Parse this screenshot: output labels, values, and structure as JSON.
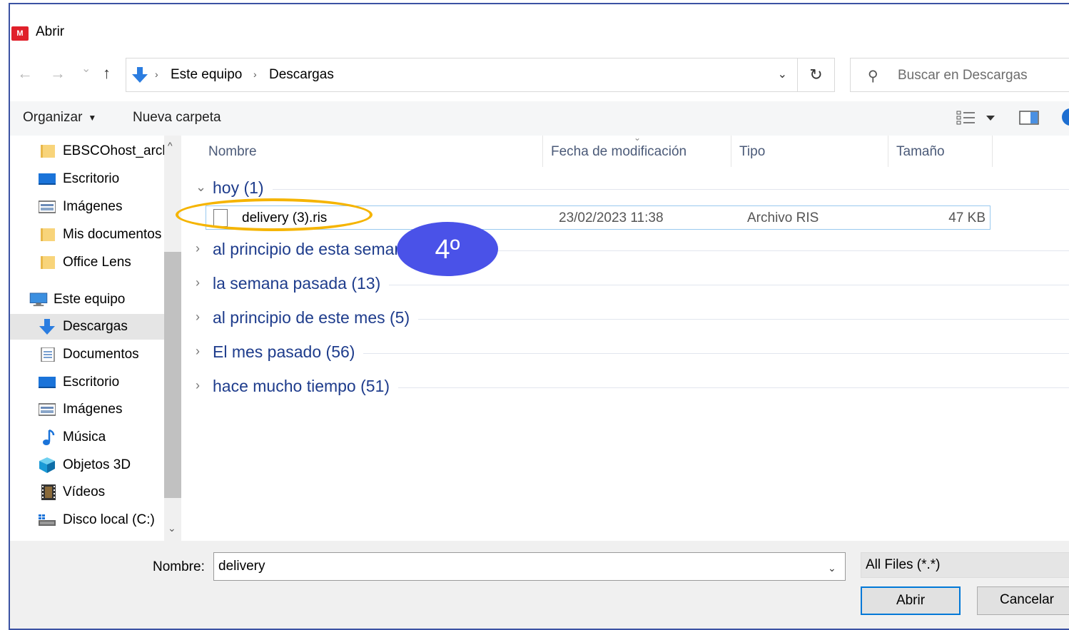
{
  "window": {
    "title": "Abrir",
    "app_icon_text": "M"
  },
  "navigation": {
    "back_icon": "←",
    "forward_icon": "→",
    "recent_icon": "⌄",
    "up_icon": "↑",
    "breadcrumb": [
      "Este equipo",
      "Descargas"
    ],
    "separator": "›",
    "dropdown_icon": "⌄",
    "refresh_icon": "↻",
    "search_placeholder": "Buscar en Descargas",
    "search_icon": "⚲"
  },
  "toolbar": {
    "organize_label": "Organizar",
    "organize_caret": "▼",
    "new_folder_label": "Nueva carpeta"
  },
  "sidebar": {
    "items": [
      {
        "label": "EBSCOhost_arch",
        "icon": "folder"
      },
      {
        "label": "Escritorio",
        "icon": "desktop"
      },
      {
        "label": "Imágenes",
        "icon": "pictures"
      },
      {
        "label": "Mis documentos",
        "icon": "folder"
      },
      {
        "label": "Office Lens",
        "icon": "folder"
      },
      {
        "label": "Este equipo",
        "icon": "computer"
      },
      {
        "label": "Descargas",
        "icon": "download",
        "selected": true
      },
      {
        "label": "Documentos",
        "icon": "documents"
      },
      {
        "label": "Escritorio",
        "icon": "desktop"
      },
      {
        "label": "Imágenes",
        "icon": "pictures"
      },
      {
        "label": "Música",
        "icon": "music"
      },
      {
        "label": "Objetos 3D",
        "icon": "objects3d"
      },
      {
        "label": "Vídeos",
        "icon": "videos"
      },
      {
        "label": "Disco local (C:)",
        "icon": "drive"
      }
    ],
    "scroll_up": "^",
    "scroll_down": "⌄"
  },
  "columns": {
    "name": "Nombre",
    "date": "Fecha de modificación",
    "type": "Tipo",
    "size": "Tamaño",
    "sort_icon": "⌄"
  },
  "groups": [
    {
      "label": "hoy (1)",
      "expanded": true,
      "chevron": "⌄"
    },
    {
      "label": "al principio de esta semana (4)",
      "expanded": false,
      "chevron": "›"
    },
    {
      "label": "la semana pasada (13)",
      "expanded": false,
      "chevron": "›"
    },
    {
      "label": "al principio de este mes (5)",
      "expanded": false,
      "chevron": "›"
    },
    {
      "label": "El mes pasado (56)",
      "expanded": false,
      "chevron": "›"
    },
    {
      "label": "hace mucho tiempo (51)",
      "expanded": false,
      "chevron": "›"
    }
  ],
  "file": {
    "name": "delivery (3).ris",
    "date": "23/02/2023 11:38",
    "type": "Archivo RIS",
    "size": "47 KB"
  },
  "annotation": {
    "step_label": "4º",
    "highlight_color": "#f5b400",
    "badge_color": "#4a52e8"
  },
  "bottom": {
    "name_label": "Nombre:",
    "name_value": "delivery",
    "name_dropdown": "⌄",
    "type_filter": "All Files (*.*)",
    "open_button": "Abrir",
    "cancel_button": "Cancelar"
  }
}
